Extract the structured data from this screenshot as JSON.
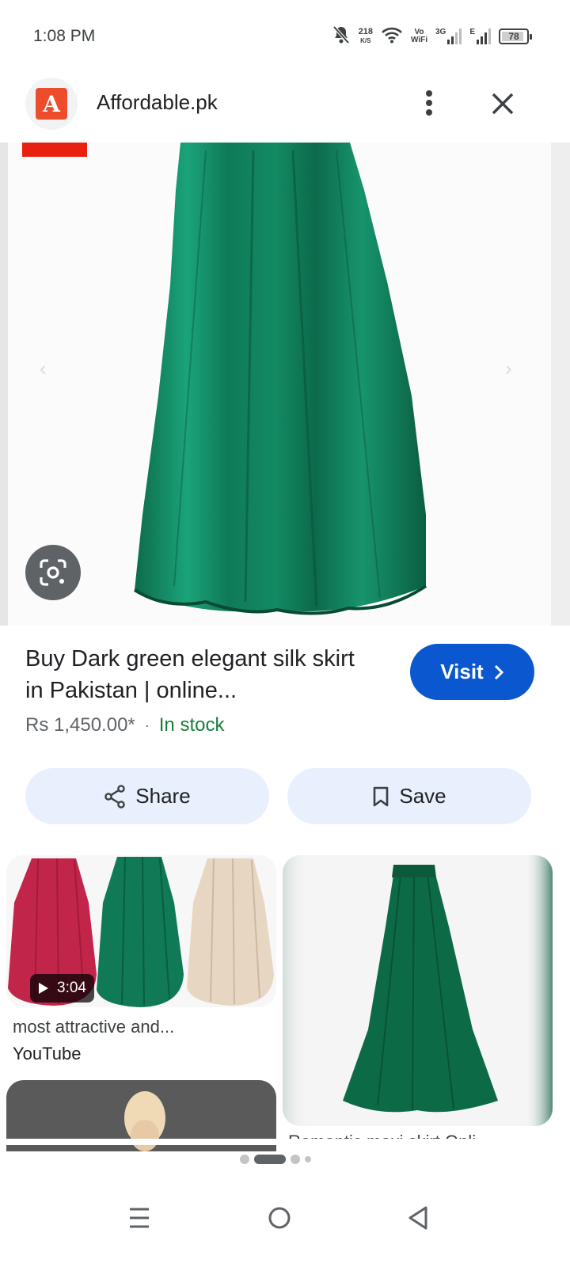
{
  "status_bar": {
    "time": "1:08 PM",
    "net_speed_value": "218",
    "net_speed_unit": "K/S",
    "vo_label": "Vo",
    "wifi_label": "WiFi",
    "network_3g": "3G",
    "network_e": "E",
    "battery_level": "78",
    "icons": [
      "bell-off-icon",
      "wifi-icon",
      "signal-icon",
      "battery-icon"
    ]
  },
  "header": {
    "logo_letter": "A",
    "site_name": "Affordable.pk",
    "brand_color": "#ee4d2d"
  },
  "product": {
    "title": "Buy Dark green elegant silk skirt in Pakistan | online...",
    "visit_label": "Visit",
    "price": "Rs 1,450.00*",
    "stock": "In stock",
    "accent_color": "#0b57d0",
    "stock_color": "#188038"
  },
  "actions": {
    "share_label": "Share",
    "save_label": "Save"
  },
  "related": [
    {
      "duration": "3:04",
      "caption": "most attractive and...",
      "source": "YouTube"
    },
    {
      "caption": "Romantic maxi skirt Onli..."
    }
  ],
  "carousel": {
    "dot_count": 4,
    "active_dot": 1
  }
}
